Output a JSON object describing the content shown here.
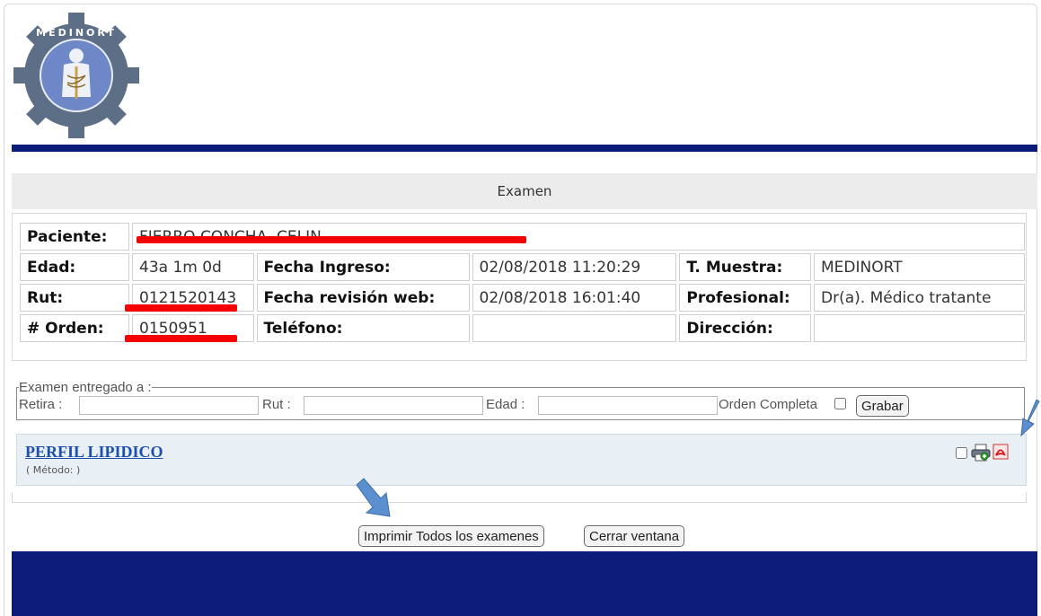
{
  "header": {
    "section_title": "Examen"
  },
  "patient": {
    "paciente_label": "Paciente:",
    "paciente_value": "FIERRO CONCHA, CELIN",
    "edad_label": "Edad:",
    "edad_value": "43a 1m 0d",
    "fecha_ingreso_label": "Fecha Ingreso:",
    "fecha_ingreso_value": "02/08/2018 11:20:29",
    "t_muestra_label": "T. Muestra:",
    "t_muestra_value": "MEDINORT",
    "rut_label": "Rut:",
    "rut_value": "0121520143",
    "fecha_revision_label": "Fecha revisión web:",
    "fecha_revision_value": "02/08/2018 16:01:40",
    "profesional_label": "Profesional:",
    "profesional_value": "Dr(a). Médico tratante",
    "orden_label": "# Orden:",
    "orden_value": "0150951",
    "telefono_label": "Teléfono:",
    "telefono_value": "",
    "direccion_label": "Dirección:",
    "direccion_value": ""
  },
  "delivery": {
    "legend": "Examen entregado a :",
    "retira_label": "Retira :",
    "retira_value": "",
    "rut_label": "Rut :",
    "rut_value": "",
    "edad_label": "Edad :",
    "edad_value": "",
    "orden_completa_label": "Orden Completa",
    "grabar_label": "Grabar"
  },
  "exam": {
    "name": "PERFIL LIPIDICO",
    "method": "( Método: )"
  },
  "footer": {
    "print_all_label": "Imprimir Todos los examenes",
    "close_label": "Cerrar ventana"
  },
  "colors": {
    "navy": "#0c1a79",
    "redaction": "#f40000",
    "link": "#1d4fb0",
    "arrow": "#5b8fcf"
  },
  "icons": [
    "medinort-logo",
    "print-icon",
    "pdf-icon",
    "arrow-icon"
  ]
}
